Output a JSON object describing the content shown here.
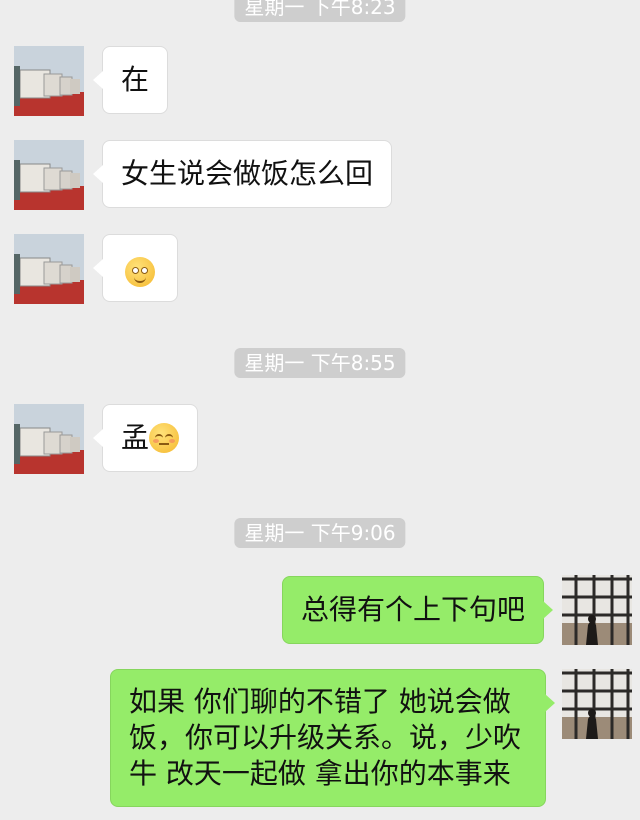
{
  "timestamps": [
    "星期一 下午8:23",
    "星期一 下午8:55",
    "星期一 下午9:06"
  ],
  "messages": [
    {
      "side": "left",
      "text": "在",
      "emoji": null
    },
    {
      "side": "left",
      "text": "女生说会做饭怎么回",
      "emoji": null
    },
    {
      "side": "left",
      "text": "",
      "emoji": "smiling-face-emoji"
    },
    {
      "side": "left",
      "text": "孟",
      "emoji": "unamused-face-emoji"
    },
    {
      "side": "right",
      "text": "总得有个上下句吧",
      "emoji": null
    },
    {
      "side": "right",
      "text": "如果 你们聊的不错了 她说会做饭，你可以升级关系。说，少吹牛 改天一起做 拿出你的本事来",
      "emoji": null
    }
  ],
  "colors": {
    "background": "#ededed",
    "left_bubble": "#ffffff",
    "right_bubble": "#95ec69",
    "timestamp_bg": "#cecece"
  }
}
